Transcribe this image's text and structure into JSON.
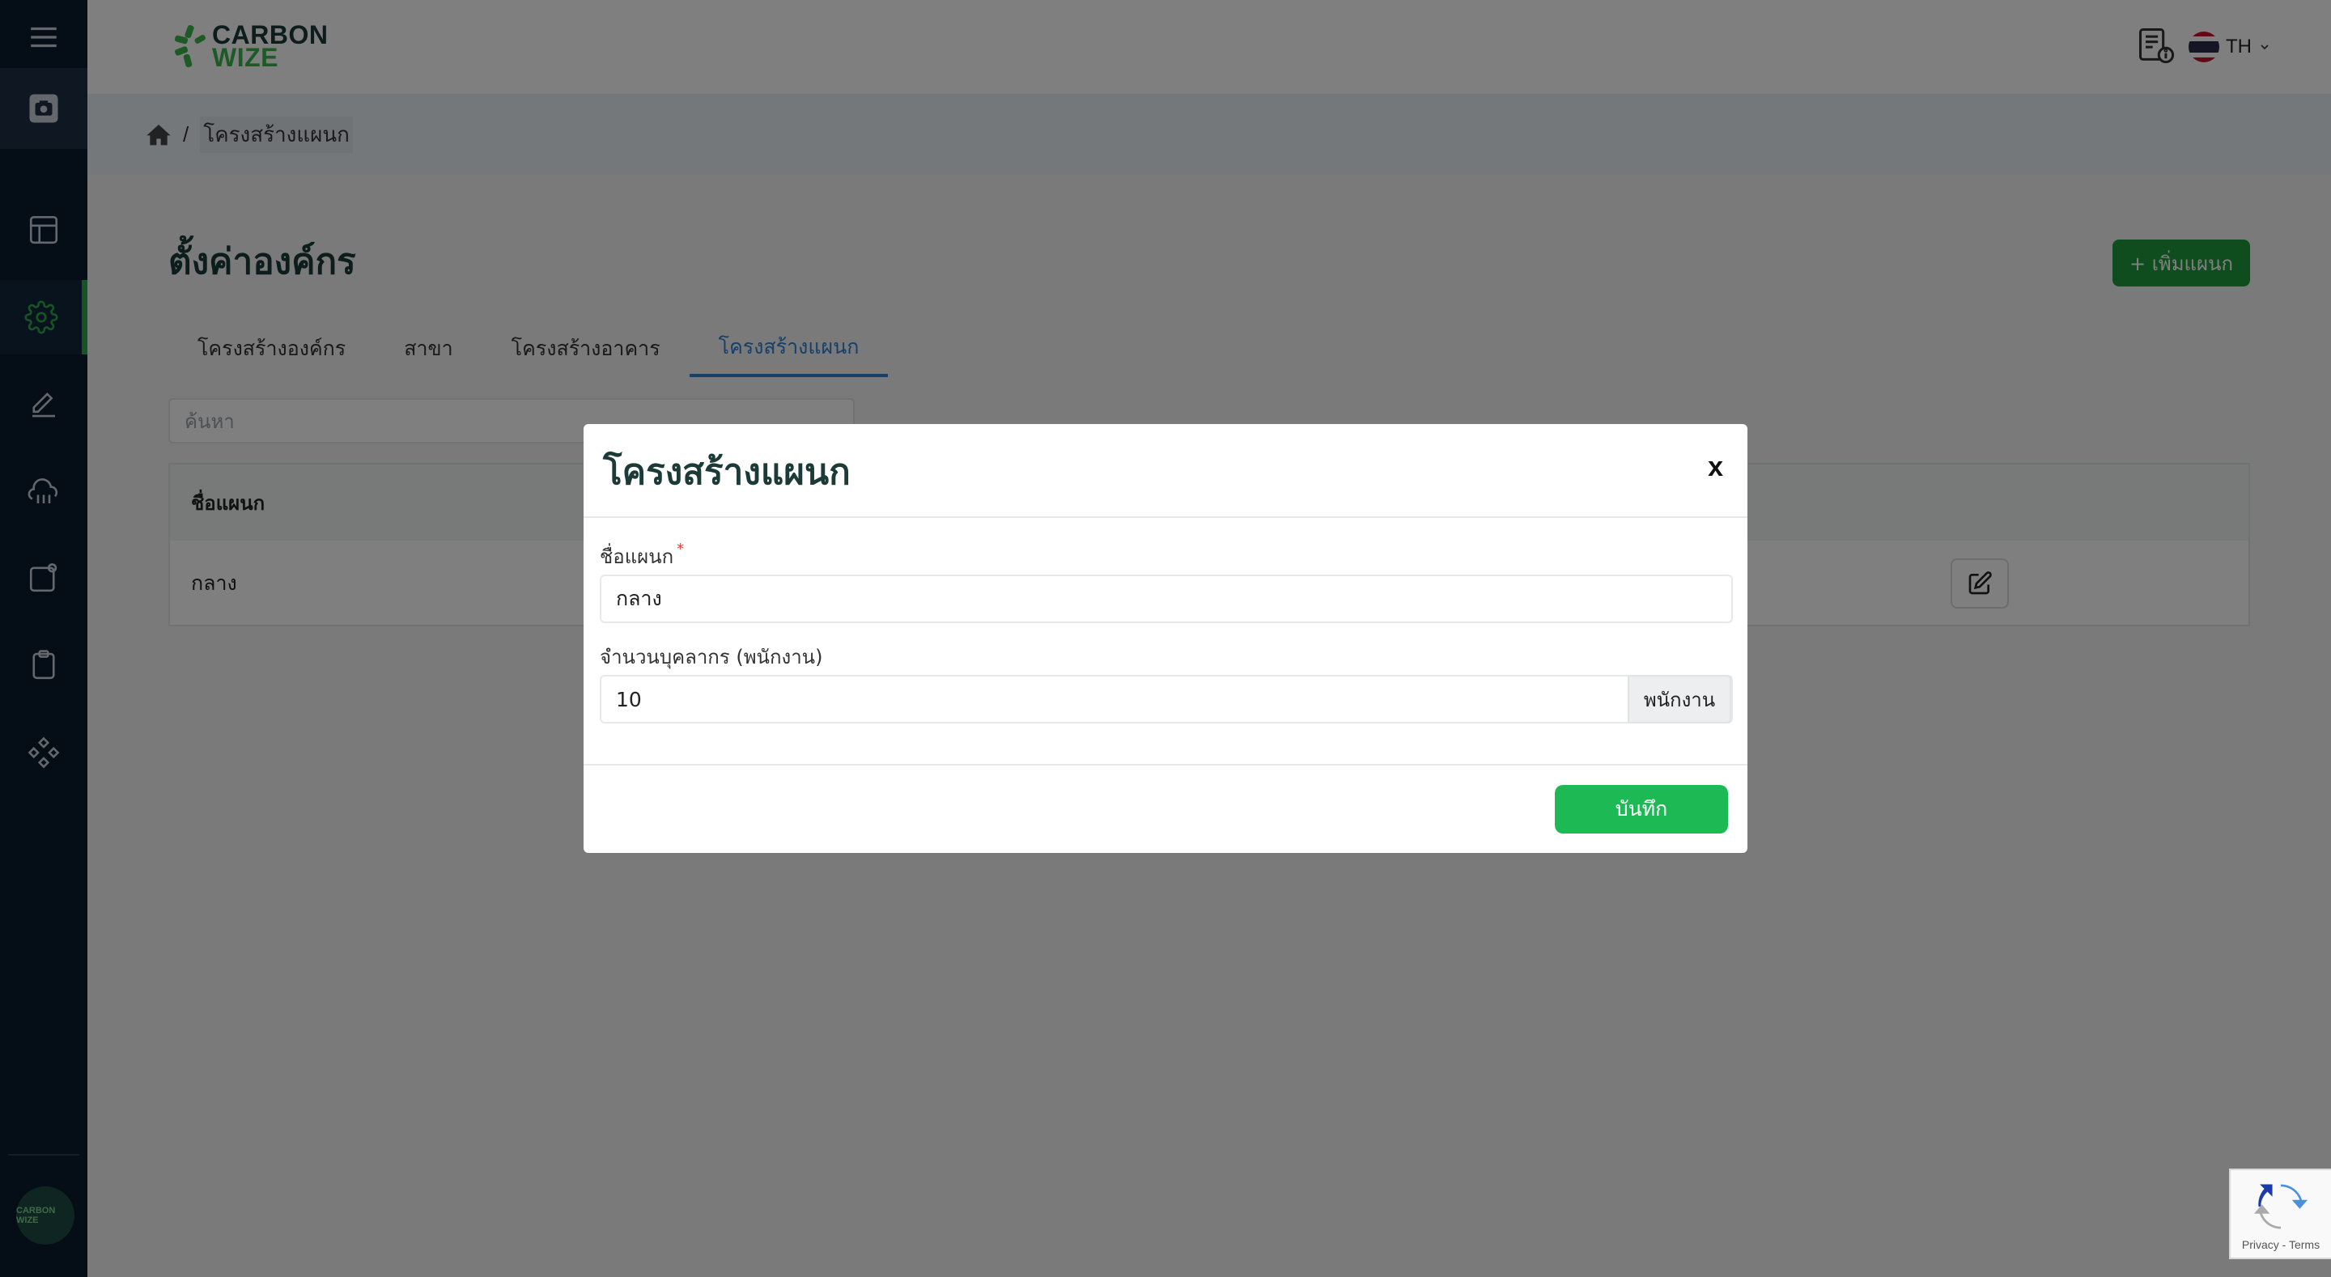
{
  "header": {
    "logo_line1": "CARBON",
    "logo_line2": "WIZE",
    "language": "TH"
  },
  "breadcrumb": {
    "separator": "/",
    "current": "โครงสร้างแผนก"
  },
  "page": {
    "title": "ตั้งค่าองค์กร",
    "add_button": "+ เพิ่มแผนก",
    "tabs": [
      {
        "label": "โครงสร้างองค์กร",
        "active": false
      },
      {
        "label": "สาขา",
        "active": false
      },
      {
        "label": "โครงสร้างอาคาร",
        "active": false
      },
      {
        "label": "โครงสร้างแผนก",
        "active": true
      }
    ],
    "search_placeholder": "ค้นหา",
    "table": {
      "columns": [
        "ชื่อแผนก"
      ],
      "rows": [
        [
          "กลาง"
        ]
      ]
    }
  },
  "modal": {
    "title": "โครงสร้างแผนก",
    "close_label": "x",
    "name_label": "ชื่อแผนก",
    "name_required_mark": "*",
    "name_value": "กลาง",
    "staff_label": "จำนวนบุคลากร (พนักงาน)",
    "staff_value": "10",
    "staff_unit": "พนักงาน",
    "save_button": "บันทึก"
  },
  "sidebar": {
    "items": [
      "menu-icon",
      "camera-icon",
      "layout-icon",
      "gear-icon",
      "pencil-icon",
      "cloud-icon",
      "report-icon",
      "clipboard-icon",
      "components-icon"
    ],
    "active_index": 3,
    "avatar_text": "CARBON WIZE"
  },
  "recaptcha": {
    "text": "Privacy - Terms"
  },
  "colors": {
    "sidebar_bg": "#0b1a2c",
    "accent_green": "#1db954",
    "add_button_green": "#1f9b3f",
    "tab_active_blue": "#2d7fd3",
    "title_dark": "#1b3a38"
  }
}
